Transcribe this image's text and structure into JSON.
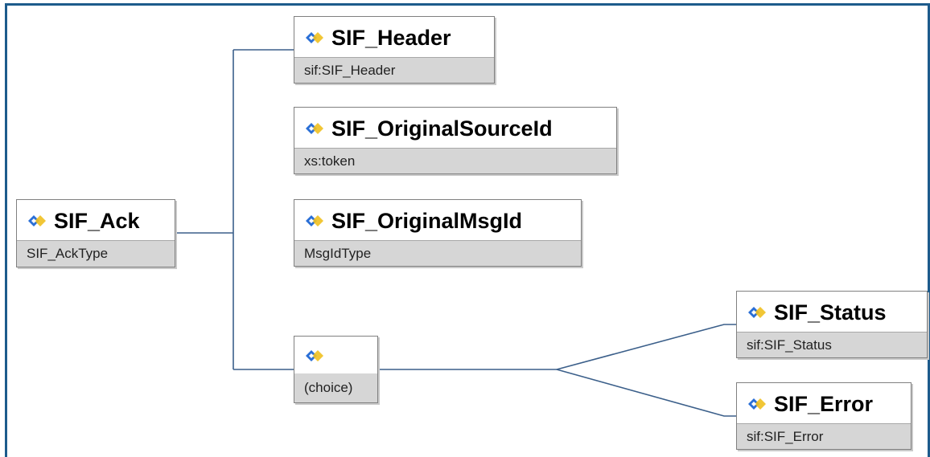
{
  "colors": {
    "frame": "#1d5b8c",
    "connector": "#3b5f8a",
    "type_band": "#d6d6d6",
    "icon_blue": "#2a6fd6",
    "icon_yellow": "#f0c020"
  },
  "icon": "element-diamond-icon",
  "root": {
    "name": "SIF_Ack",
    "type": "SIF_AckType"
  },
  "children": [
    {
      "name": "SIF_Header",
      "type": "sif:SIF_Header"
    },
    {
      "name": "SIF_OriginalSourceId",
      "type": "xs:token"
    },
    {
      "name": "SIF_OriginalMsgId",
      "type": "MsgIdType"
    }
  ],
  "choice": {
    "label": "(choice)",
    "options": [
      {
        "name": "SIF_Status",
        "type": "sif:SIF_Status"
      },
      {
        "name": "SIF_Error",
        "type": "sif:SIF_Error"
      }
    ]
  }
}
